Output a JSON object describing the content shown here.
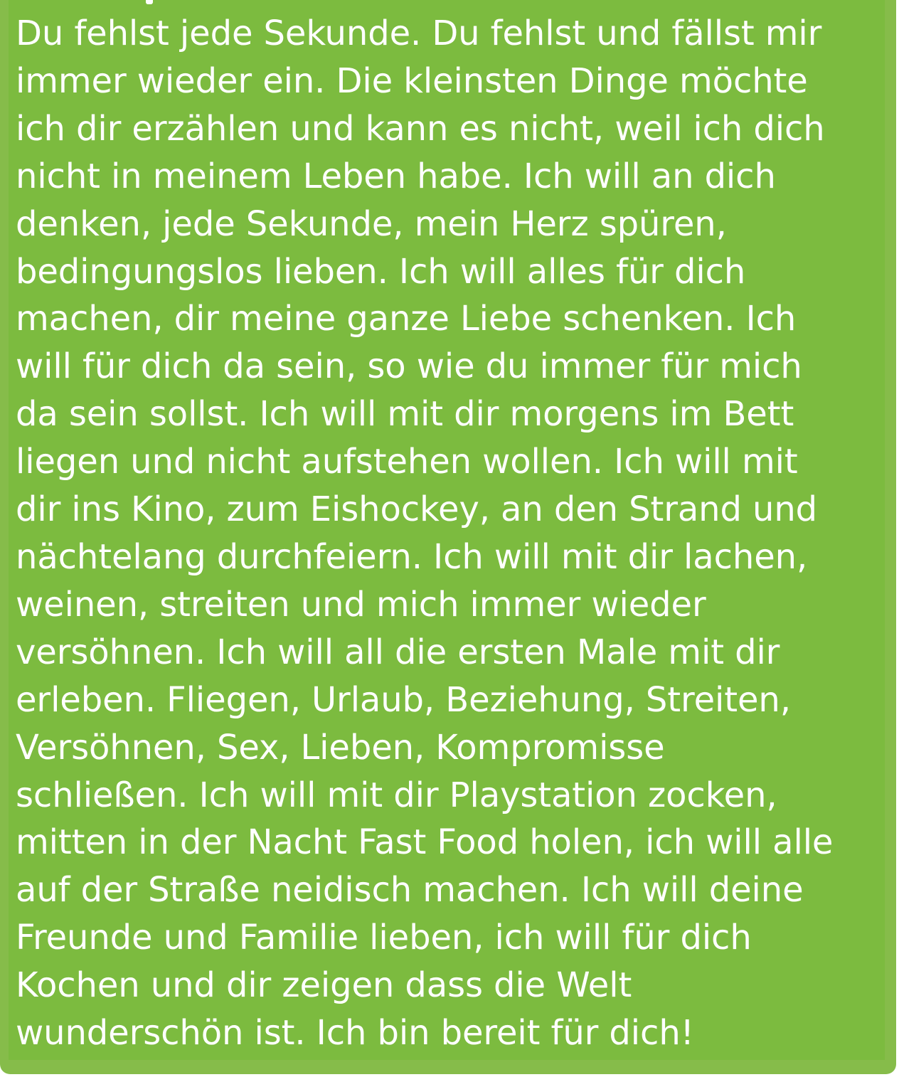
{
  "message": {
    "lines": [
      "Du fehlst jede Sekunde. Du fehlst und fällst mir",
      "immer wieder ein. Die kleinsten Dinge möchte",
      "ich dir erzählen und kann es nicht, weil ich dich",
      "nicht in meinem Leben habe. Ich will an dich",
      "denken, jede Sekunde, mein Herz spüren,",
      "bedingungslos lieben. Ich will alles für dich",
      "machen, dir meine ganze Liebe schenken. Ich",
      "will für dich da sein, so wie du immer für mich",
      "da sein sollst. Ich will mit dir morgens im Bett",
      "liegen und nicht aufstehen wollen. Ich will mit",
      "dir ins Kino, zum Eishockey, an den Strand und",
      "nächtelang durchfeiern. Ich will mit dir lachen,",
      "weinen, streiten und mich immer wieder",
      "versöhnen. Ich will all die ersten Male mit dir",
      "erleben. Fliegen, Urlaub, Beziehung, Streiten,",
      "Versöhnen, Sex, Lieben, Kompromisse",
      "schließen. Ich will mit dir Playstation zocken,",
      "mitten in der Nacht Fast Food holen, ich will alle",
      "auf der Straße neidisch machen. Ich will deine",
      "Freunde und Familie lieben, ich will für dich",
      "Kochen und dir zeigen dass die Welt",
      "wunderschön ist. Ich bin bereit für dich!"
    ]
  },
  "colors": {
    "bubble": "#86bc4a",
    "bubble_inner": "#7cbb3f",
    "text": "#ffffff",
    "background": "#ffffff"
  }
}
